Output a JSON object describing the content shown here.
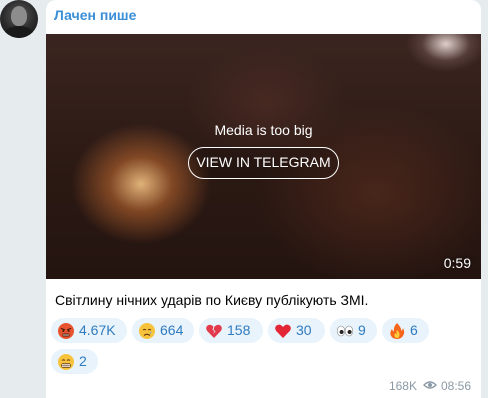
{
  "post": {
    "author": "Лачен пише",
    "media_notice": "Media is too big",
    "view_button_label": "VIEW IN TELEGRAM",
    "duration": "0:59",
    "caption": "Світлину нічних ударів по Києву публікують ЗМІ.",
    "reactions": [
      {
        "emoji": "angry-face-icon",
        "count": "4.67K"
      },
      {
        "emoji": "crying-face-icon",
        "count": "664"
      },
      {
        "emoji": "broken-heart-icon",
        "count": "158"
      },
      {
        "emoji": "red-heart-icon",
        "count": "30"
      },
      {
        "emoji": "eyes-icon",
        "count": "9"
      },
      {
        "emoji": "fire-icon",
        "count": "6"
      },
      {
        "emoji": "grimacing-face-icon",
        "count": "2"
      }
    ],
    "views": "168K",
    "time": "08:56"
  },
  "colors": {
    "author": "#3a8fd6",
    "reaction_bg": "#e8f3fb",
    "reaction_text": "#2f7bc0",
    "background": "#e6ebee"
  }
}
